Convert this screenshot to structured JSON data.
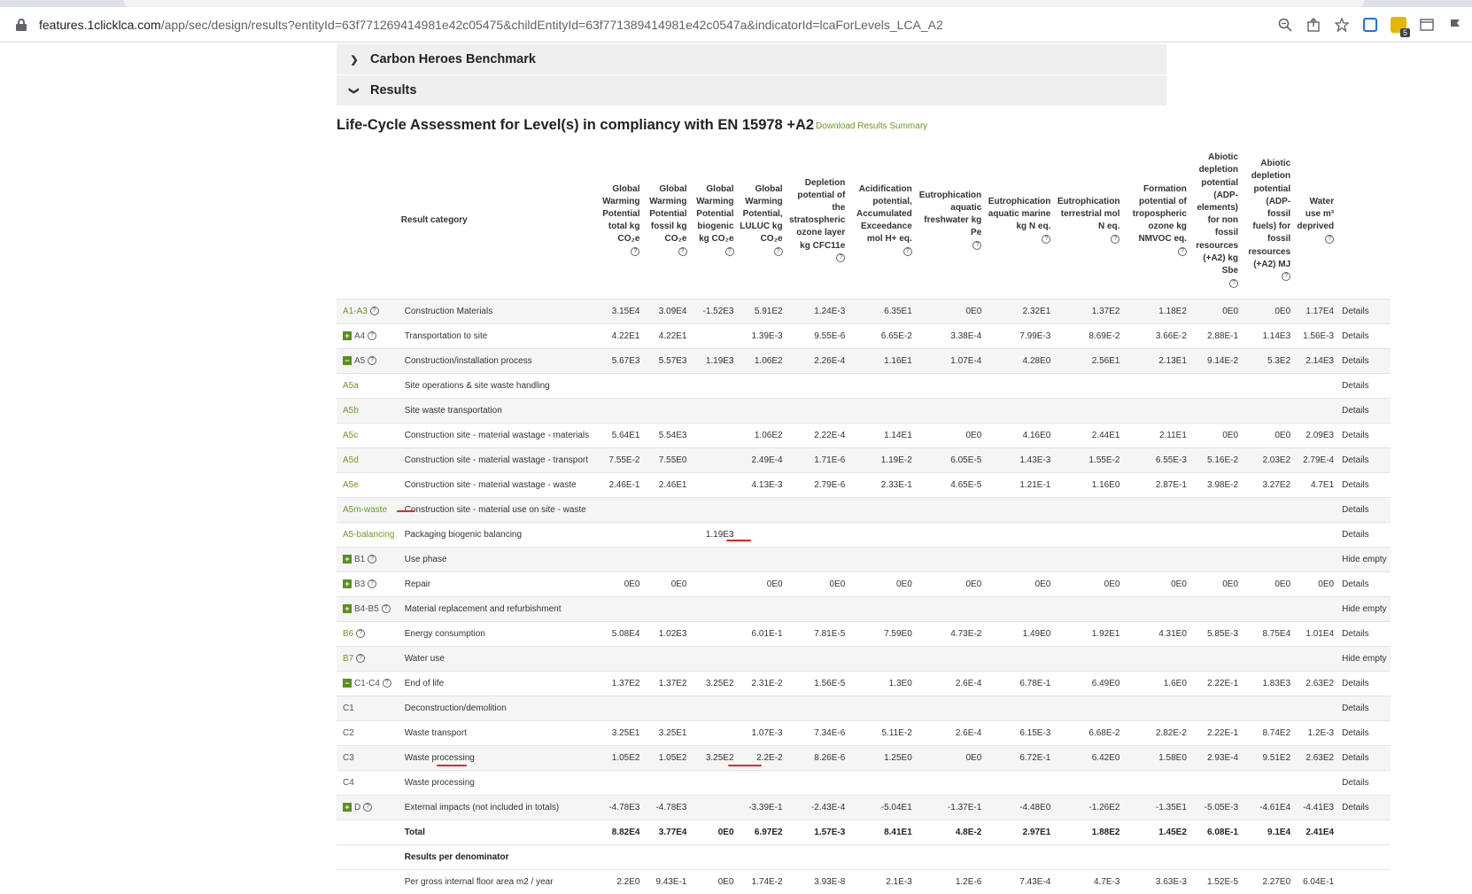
{
  "browser": {
    "url_host": "features.1clicklca.com",
    "url_path": "/app/sec/design/results?entityId=63f771269414981e42c05475&childEntityId=63f771389414981e42c0547a&indicatorId=lcaForLevels_LCA_A2",
    "extension_badge": "5"
  },
  "sections": {
    "benchmark_label": "Carbon Heroes Benchmark",
    "results_label": "Results"
  },
  "heading": "Life-Cycle Assessment for Level(s) in compliancy with EN 15978 +A2",
  "download_link": "Download Results Summary",
  "table": {
    "category_header": "Result category",
    "headers": [
      "Global Warming Potential total kg CO₂e",
      "Global Warming Potential fossil kg CO₂e",
      "Global Warming Potential biogenic kg CO₂e",
      "Global Warming Potential, LULUC kg CO₂e",
      "Depletion potential of the stratospheric ozone layer kg CFC11e",
      "Acidification potential, Accumulated Exceedance mol H+ eq.",
      "Eutrophication aquatic freshwater kg Pe",
      "Eutrophication aquatic marine kg N eq.",
      "Eutrophication terrestrial mol N eq.",
      "Formation potential of tropospheric ozone kg NMVOC eq.",
      "Abiotic depletion potential (ADP-elements) for non fossil resources (+A2) kg Sbe",
      "Abiotic depletion potential (ADP-fossil fuels) for fossil resources (+A2) MJ",
      "Water use m³ deprived"
    ],
    "rows": [
      {
        "code": "A1-A3",
        "icon": "",
        "help": true,
        "label": "Construction Materials",
        "green": true,
        "values": [
          "3.15E4",
          "3.09E4",
          "-1.52E3",
          "5.91E2",
          "1.24E-3",
          "6.35E1",
          "0E0",
          "2.32E1",
          "1.37E2",
          "1.18E2",
          "0E0",
          "0E0",
          "1.17E4"
        ],
        "action": "Details"
      },
      {
        "code": "A4",
        "icon": "plus",
        "help": true,
        "label": "Transportation to site",
        "green": false,
        "values": [
          "4.22E1",
          "4.22E1",
          "",
          "1.39E-3",
          "9.55E-6",
          "6.65E-2",
          "3.38E-4",
          "7.99E-3",
          "8.69E-2",
          "3.66E-2",
          "2.88E-1",
          "1.14E3",
          "1.56E-3"
        ],
        "action": "Details"
      },
      {
        "code": "A5",
        "icon": "minus",
        "help": true,
        "label": "Construction/installation process",
        "green": true,
        "values": [
          "5.67E3",
          "5.57E3",
          "1.19E3",
          "1.06E2",
          "2.26E-4",
          "1.16E1",
          "1.07E-4",
          "4.28E0",
          "2.56E1",
          "2.13E1",
          "9.14E-2",
          "5.3E2",
          "2.14E3"
        ],
        "action": "Details"
      },
      {
        "code": "A5a",
        "icon": "",
        "help": false,
        "label": "Site operations & site waste handling",
        "green": true,
        "values": [
          "",
          "",
          "",
          "",
          "",
          "",
          "",
          "",
          "",
          "",
          "",
          "",
          ""
        ],
        "action": "Details"
      },
      {
        "code": "A5b",
        "icon": "",
        "help": false,
        "label": "Site waste transportation",
        "green": true,
        "values": [
          "",
          "",
          "",
          "",
          "",
          "",
          "",
          "",
          "",
          "",
          "",
          "",
          ""
        ],
        "action": "Details"
      },
      {
        "code": "A5c",
        "icon": "",
        "help": false,
        "label": "Construction site - material wastage - materials",
        "green": true,
        "values": [
          "5.64E1",
          "5.54E3",
          "",
          "1.06E2",
          "2.22E-4",
          "1.14E1",
          "0E0",
          "4.16E0",
          "2.44E1",
          "2.11E1",
          "0E0",
          "0E0",
          "2.09E3"
        ],
        "action": "Details"
      },
      {
        "code": "A5d",
        "icon": "",
        "help": false,
        "label": "Construction site - material wastage - transport",
        "green": true,
        "values": [
          "7.55E-2",
          "7.55E0",
          "",
          "2.49E-4",
          "1.71E-6",
          "1.19E-2",
          "6.05E-5",
          "1.43E-3",
          "1.55E-2",
          "6.55E-3",
          "5.16E-2",
          "2.03E2",
          "2.79E-4"
        ],
        "action": "Details"
      },
      {
        "code": "A5e",
        "icon": "",
        "help": false,
        "label": "Construction site - material wastage - waste",
        "green": true,
        "values": [
          "2.46E-1",
          "2.46E1",
          "",
          "4.13E-3",
          "2.79E-6",
          "2.33E-1",
          "4.65E-5",
          "1.21E-1",
          "1.16E0",
          "2.87E-1",
          "3.98E-2",
          "3.27E2",
          "4.7E1"
        ],
        "action": "Details"
      },
      {
        "code": "A5m-waste",
        "icon": "",
        "help": false,
        "label": "Construction site - material use on site - waste",
        "green": true,
        "values": [
          "",
          "",
          "",
          "",
          "",
          "",
          "",
          "",
          "",
          "",
          "",
          "",
          ""
        ],
        "action": "Details"
      },
      {
        "code": "A5-balancing",
        "icon": "",
        "help": false,
        "label": "Packaging biogenic balancing",
        "green": true,
        "values": [
          "",
          "",
          "1.19E3",
          "",
          "",
          "",
          "",
          "",
          "",
          "",
          "",
          "",
          ""
        ],
        "action": "Details"
      },
      {
        "code": "B1",
        "icon": "plus",
        "help": true,
        "label": "Use phase",
        "green": true,
        "values": [
          "",
          "",
          "",
          "",
          "",
          "",
          "",
          "",
          "",
          "",
          "",
          "",
          ""
        ],
        "action": "Hide empty"
      },
      {
        "code": "B3",
        "icon": "plus",
        "help": true,
        "label": "Repair",
        "green": true,
        "values": [
          "0E0",
          "0E0",
          "",
          "0E0",
          "0E0",
          "0E0",
          "0E0",
          "0E0",
          "0E0",
          "0E0",
          "0E0",
          "0E0",
          "0E0"
        ],
        "action": "Details"
      },
      {
        "code": "B4-B5",
        "icon": "plus",
        "help": true,
        "label": "Material replacement and refurbishment",
        "green": true,
        "values": [
          "",
          "",
          "",
          "",
          "",
          "",
          "",
          "",
          "",
          "",
          "",
          "",
          ""
        ],
        "action": "Hide empty"
      },
      {
        "code": "B6",
        "icon": "",
        "help": true,
        "label": "Energy consumption",
        "green": true,
        "values": [
          "5.08E4",
          "1.02E3",
          "",
          "6.01E-1",
          "7.81E-5",
          "7.59E0",
          "4.73E-2",
          "1.49E0",
          "1.92E1",
          "4.31E0",
          "5.85E-3",
          "8.75E4",
          "1.01E4"
        ],
        "action": "Details"
      },
      {
        "code": "B7",
        "icon": "",
        "help": true,
        "label": "Water use",
        "green": true,
        "values": [
          "",
          "",
          "",
          "",
          "",
          "",
          "",
          "",
          "",
          "",
          "",
          "",
          ""
        ],
        "action": "Hide empty"
      },
      {
        "code": "C1-C4",
        "icon": "minus",
        "help": true,
        "label": "End of life",
        "green": false,
        "values": [
          "1.37E2",
          "1.37E2",
          "3.25E2",
          "2.31E-2",
          "1.56E-5",
          "1.3E0",
          "2.6E-4",
          "6.78E-1",
          "6.49E0",
          "1.6E0",
          "2.22E-1",
          "1.83E3",
          "2.63E2"
        ],
        "action": "Details"
      },
      {
        "code": "C1",
        "icon": "",
        "help": false,
        "label": "Deconstruction/demolition",
        "green": false,
        "values": [
          "",
          "",
          "",
          "",
          "",
          "",
          "",
          "",
          "",
          "",
          "",
          "",
          ""
        ],
        "action": "Details"
      },
      {
        "code": "C2",
        "icon": "",
        "help": false,
        "label": "Waste transport",
        "green": false,
        "values": [
          "3.25E1",
          "3.25E1",
          "",
          "1.07E-3",
          "7.34E-6",
          "5.11E-2",
          "2.6E-4",
          "6.15E-3",
          "6.68E-2",
          "2.82E-2",
          "2.22E-1",
          "8.74E2",
          "1.2E-3"
        ],
        "action": "Details"
      },
      {
        "code": "C3",
        "icon": "",
        "help": false,
        "label": "Waste processing",
        "green": false,
        "values": [
          "1.05E2",
          "1.05E2",
          "3.25E2",
          "2.2E-2",
          "8.26E-6",
          "1.25E0",
          "0E0",
          "6.72E-1",
          "6.42E0",
          "1.58E0",
          "2.93E-4",
          "9.51E2",
          "2.63E2"
        ],
        "action": "Details"
      },
      {
        "code": "C4",
        "icon": "",
        "help": false,
        "label": "Waste processing",
        "green": false,
        "values": [
          "",
          "",
          "",
          "",
          "",
          "",
          "",
          "",
          "",
          "",
          "",
          "",
          ""
        ],
        "action": "Details"
      },
      {
        "code": "D",
        "icon": "plus",
        "help": true,
        "label": "External impacts (not included in totals)",
        "green": false,
        "values": [
          "-4.78E3",
          "-4.78E3",
          "",
          "-3.39E-1",
          "-2.43E-4",
          "-5.04E1",
          "-1.37E-1",
          "-4.48E0",
          "-1.26E2",
          "-1.35E1",
          "-5.05E-3",
          "-4.61E4",
          "-4.41E3"
        ],
        "action": "Details"
      }
    ],
    "total_label": "Total",
    "total_values": [
      "8.82E4",
      "3.77E4",
      "0E0",
      "6.97E2",
      "1.57E-3",
      "8.41E1",
      "4.8E-2",
      "2.97E1",
      "1.88E2",
      "1.45E2",
      "6.08E-1",
      "9.1E4",
      "2.41E4"
    ],
    "denominator_label": "Results per denominator",
    "partial_label": "Per gross internal floor area m2 / year",
    "partial_values": [
      "2.2E0",
      "9.43E-1",
      "0E0",
      "1.74E-2",
      "3.93E-8",
      "2.1E-3",
      "1.2E-6",
      "7.43E-4",
      "4.7E-3",
      "3.63E-3",
      "1.52E-5",
      "2.27E0",
      "6.04E-1"
    ]
  }
}
